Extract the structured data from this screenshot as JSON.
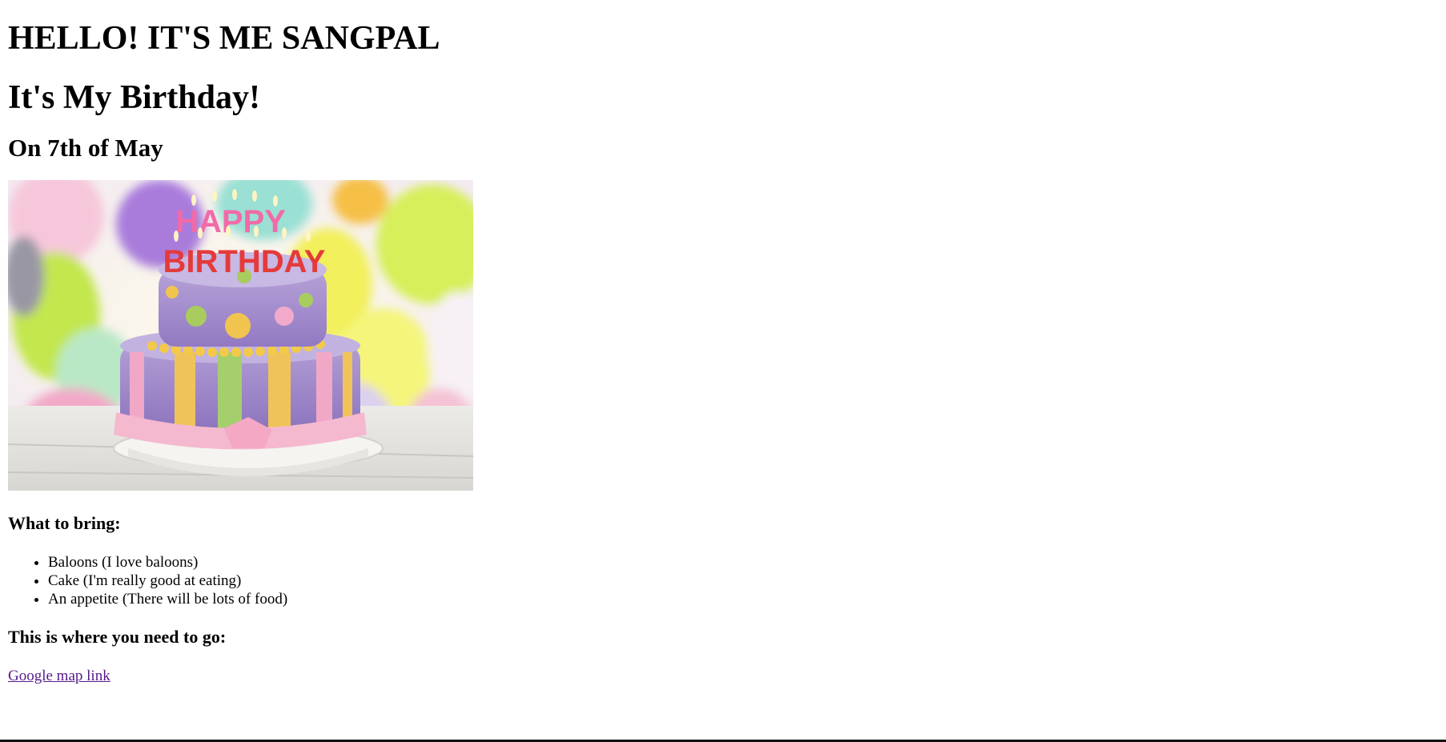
{
  "page": {
    "heading_main": "HELLO! IT'S ME SANGPAL",
    "heading_sub": "It's My Birthday!",
    "heading_date": "On 7th of May",
    "image": {
      "subject": "birthday-cake-photo",
      "candle_text_line1": "HAPPY",
      "candle_text_line2": "BIRTHDAY"
    },
    "bring_heading": "What to bring:",
    "bring_items": [
      "Baloons (I love baloons)",
      "Cake (I'm really good at eating)",
      "An appetite (There will be lots of food)"
    ],
    "where_heading": "This is where you need to go:",
    "map_link_text": "Google map link"
  },
  "colors": {
    "link_visited": "#551a8b",
    "text": "#000000",
    "background": "#ffffff"
  }
}
